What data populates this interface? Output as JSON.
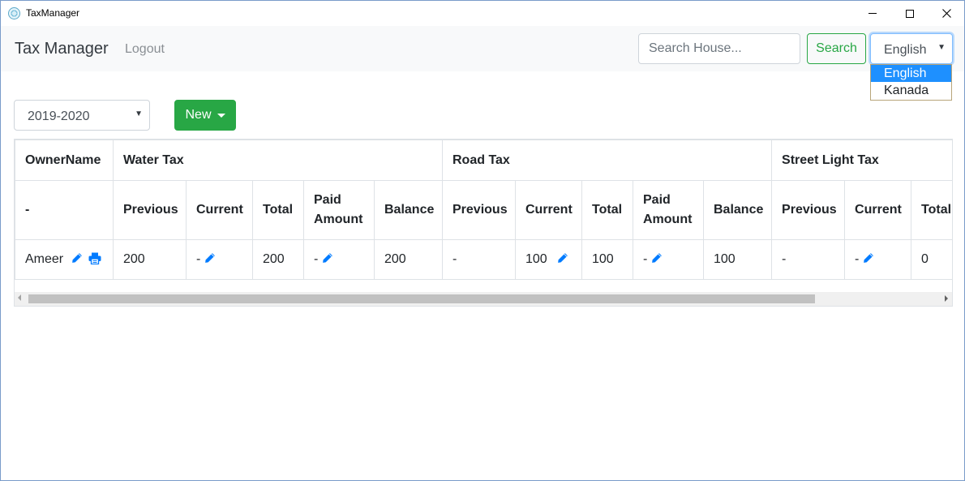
{
  "window": {
    "title": "TaxManager"
  },
  "navbar": {
    "brand": "Tax Manager",
    "logout": "Logout",
    "search_placeholder": "Search House...",
    "search_button": "Search",
    "language_selected": "English",
    "language_options": [
      "English",
      "Kanada"
    ]
  },
  "controls": {
    "year_selected": "2019-2020",
    "new_button": "New"
  },
  "table": {
    "group_headers": [
      "OwnerName",
      "Water Tax",
      "Road Tax",
      "Street Light Tax"
    ],
    "sub_headers": [
      "-",
      "Previous",
      "Current",
      "Total",
      "Paid Amount",
      "Balance",
      "Previous",
      "Current",
      "Total",
      "Paid Amount",
      "Balance",
      "Previous",
      "Current",
      "Total"
    ],
    "row": {
      "owner": "Ameer",
      "water_previous": "200",
      "water_current": "-",
      "water_total": "200",
      "water_paid": "-",
      "water_balance": "200",
      "road_previous": "-",
      "road_current": "100",
      "road_total": "100",
      "road_paid": "-",
      "road_balance": "100",
      "light_previous": "-",
      "light_current": "-",
      "light_total": "0"
    }
  },
  "colors": {
    "success": "#28a745",
    "link": "#007bff",
    "selected_option": "#1e90ff"
  },
  "icons": [
    "pencil-icon",
    "print-icon",
    "chevron-down-icon"
  ]
}
